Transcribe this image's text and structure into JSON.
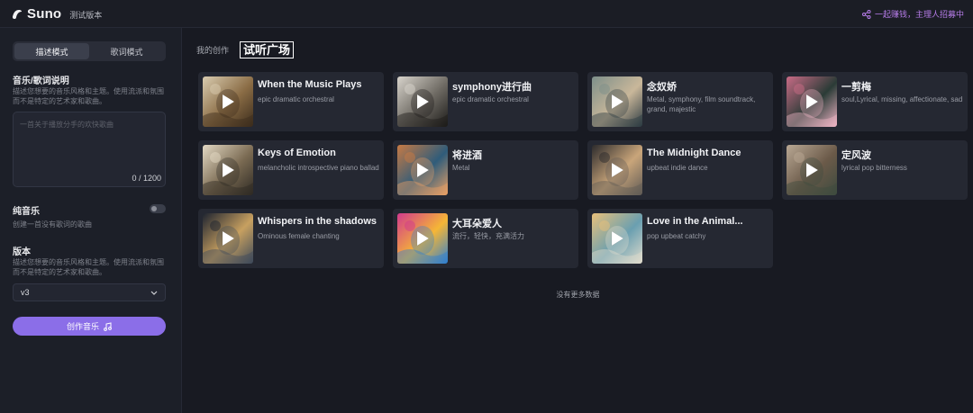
{
  "header": {
    "brand": "Suno",
    "tag": "测试版本",
    "promo": "一起赚钱，主理人招募中"
  },
  "sidebar": {
    "modes": [
      "描述模式",
      "歌词模式"
    ],
    "active_mode": "描述模式",
    "prompt_section": {
      "title": "音乐/歌词说明",
      "desc": "描述您想要的音乐风格和主题。使用流派和氛围而不是特定的艺术家和歌曲。",
      "placeholder": "一首关于播放分手的欢快歌曲",
      "counter": "0 / 1200"
    },
    "instrumental": {
      "title": "纯音乐",
      "desc": "创建一首没有歌词的歌曲",
      "enabled": false
    },
    "version": {
      "title": "版本",
      "desc": "描述您想要的音乐风格和主题。使用流派和氛围而不是特定的艺术家和歌曲。",
      "selected": "v3"
    },
    "create_label": "创作音乐"
  },
  "main": {
    "tabs": [
      "我的创作",
      "试听广场"
    ],
    "active_tab": "试听广场",
    "songs": [
      {
        "title": "When the Music Plays",
        "desc": "epic dramatic orchestral",
        "cover": "bird-guitar-sepia"
      },
      {
        "title": "symphony进行曲",
        "desc": "epic dramatic orchestral",
        "cover": "bird-ornate-bw"
      },
      {
        "title": "念奴娇",
        "desc": "Metal, symphony, film soundtrack, grand, majestic",
        "cover": "seascape-waves"
      },
      {
        "title": "一剪梅",
        "desc": "soul,Lyrical, missing, affectionate, sad",
        "cover": "pink-blossoms"
      },
      {
        "title": "Keys of Emotion",
        "desc": "melancholic introspective piano ballad",
        "cover": "bird-sketch"
      },
      {
        "title": "将进酒",
        "desc": "Metal",
        "cover": "mountain-river"
      },
      {
        "title": "The Midnight Dance",
        "desc": "upbeat indie dance",
        "cover": "bird-guitar-dark"
      },
      {
        "title": "定风波",
        "desc": "lyrical pop bitterness",
        "cover": "valley-path"
      },
      {
        "title": "Whispers in the shadows",
        "desc": "Ominous female chanting",
        "cover": "dark-forest-moon"
      },
      {
        "title": "大耳朵爱人",
        "desc": "流行，轻快，充满活力",
        "cover": "headphones-woman"
      },
      {
        "title": "Love in the Animal...",
        "desc": "pop upbeat catchy",
        "cover": "bird-colorful"
      }
    ],
    "empty_text": "没有更多数据"
  }
}
